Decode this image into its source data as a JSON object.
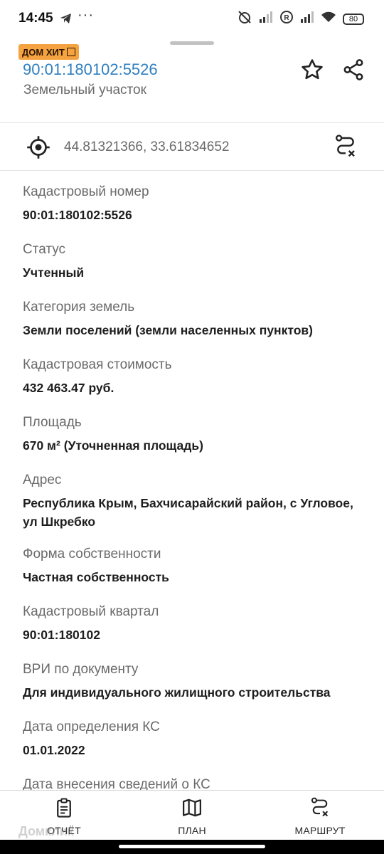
{
  "status_bar": {
    "time": "14:45",
    "dots": "···",
    "battery": "80",
    "sim_label": "R"
  },
  "header": {
    "badge": "ДОМ ХИТ",
    "parcel_id": "90:01:180102:5526",
    "parcel_type": "Земельный участок",
    "accent": "#2f7fc0",
    "badge_color": "#f4a340"
  },
  "coordinates": {
    "text": "44.81321366, 33.61834652"
  },
  "fields": [
    {
      "label": "Кадастровый номер",
      "value": "90:01:180102:5526"
    },
    {
      "label": "Статус",
      "value": "Учтенный"
    },
    {
      "label": "Категория земель",
      "value": "Земли поселений (земли населенных пунктов)"
    },
    {
      "label": "Кадастровая стоимость",
      "value": "432 463.47 руб."
    },
    {
      "label": "Площадь",
      "value": "670 м² (Уточненная площадь)"
    },
    {
      "label": "Адрес",
      "value": "Республика Крым, Бахчисарайский район, с Угловое, ул Шкребко"
    },
    {
      "label": "Форма собственности",
      "value": "Частная собственность"
    },
    {
      "label": "Кадастровый квартал",
      "value": "90:01:180102"
    },
    {
      "label": "ВРИ по документу",
      "value": "Для индивидуального жилищного строительства"
    },
    {
      "label": "Дата определения КС",
      "value": "01.01.2022"
    },
    {
      "label": "Дата внесения сведений о КС",
      "value": ""
    }
  ],
  "bottom_nav": {
    "report": "ОТЧЁТ",
    "plan": "ПЛАН",
    "route": "МАРШРУТ"
  },
  "watermark": "Домклик",
  "icons": {
    "star": "star-icon",
    "share": "share-icon",
    "target": "crosshair-icon",
    "route": "route-icon",
    "report": "clipboard-icon",
    "plan": "map-icon"
  }
}
